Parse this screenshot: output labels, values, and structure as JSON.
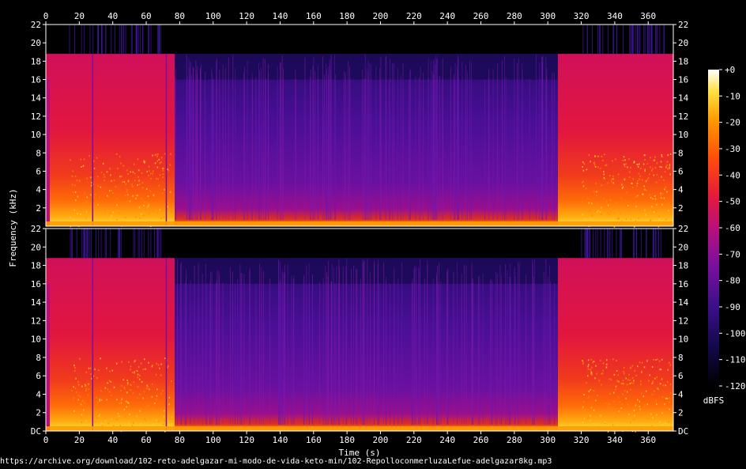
{
  "chart_data": {
    "type": "heatmap",
    "title": "",
    "xlabel": "Time (s)",
    "ylabel": "Frequency (kHz)",
    "x_ticks": [
      0,
      20,
      40,
      60,
      80,
      100,
      120,
      140,
      160,
      180,
      200,
      220,
      240,
      260,
      280,
      300,
      320,
      340,
      360
    ],
    "xlim": [
      0,
      375
    ],
    "y_ticks_top": [
      "22",
      "20",
      "18",
      "16",
      "14",
      "12",
      "10",
      "8",
      "6",
      "4",
      "2"
    ],
    "y_ticks_bottom": [
      "22",
      "20",
      "18",
      "16",
      "14",
      "12",
      "10",
      "8",
      "6",
      "4",
      "2",
      "DC"
    ],
    "ylim_khz": [
      0,
      22
    ],
    "channels": 2,
    "colorbar": {
      "unit": "dBFS",
      "ticks": [
        "+0",
        "-10",
        "-20",
        "-30",
        "-40",
        "-50",
        "-60",
        "-70",
        "-80",
        "-90",
        "-100",
        "-110",
        "-120"
      ],
      "range": [
        -120,
        0
      ]
    },
    "segments": [
      {
        "start": 0,
        "end": 77,
        "cutoff_khz": 18.8,
        "level": "loud"
      },
      {
        "start": 77,
        "end": 306,
        "cutoff_khz": 18.8,
        "level": "quiet"
      },
      {
        "start": 306,
        "end": 375,
        "cutoff_khz": 18.8,
        "level": "loud"
      }
    ],
    "colors": [
      "#000000",
      "#120a50",
      "#3d0f8c",
      "#7a0fa0",
      "#c0106c",
      "#e8153a",
      "#ff4010",
      "#ff8a00",
      "#ffd030",
      "#ffffff"
    ]
  },
  "footer_url": "https://archive.org/download/102-reto-adelgazar-mi-modo-de-vida-keto-min/102-RepolloconmerluzaLefue-adelgazar8kg.mp3"
}
